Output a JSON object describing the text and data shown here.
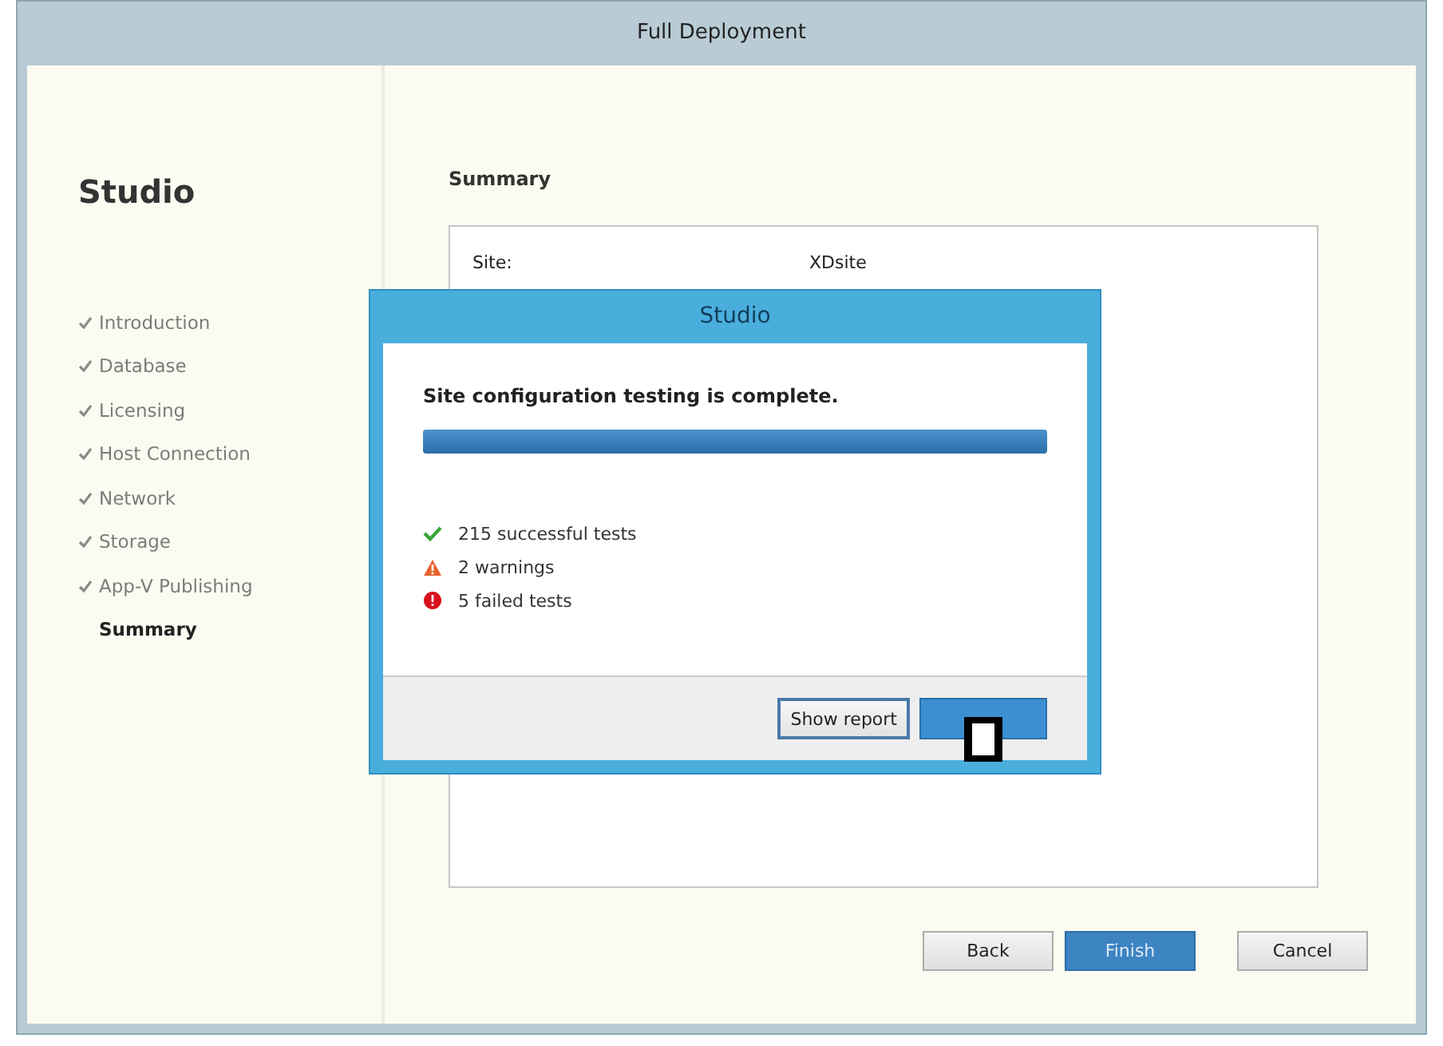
{
  "window": {
    "title": "Full Deployment"
  },
  "sidebar": {
    "title": "Studio",
    "items": [
      {
        "label": "Introduction",
        "completed": true,
        "selected": false
      },
      {
        "label": "Database",
        "completed": true,
        "selected": false
      },
      {
        "label": "Licensing",
        "completed": true,
        "selected": false
      },
      {
        "label": "Host Connection",
        "completed": true,
        "selected": false
      },
      {
        "label": "Network",
        "completed": true,
        "selected": false
      },
      {
        "label": "Storage",
        "completed": true,
        "selected": false
      },
      {
        "label": "App-V Publishing",
        "completed": true,
        "selected": false
      },
      {
        "label": "Summary",
        "completed": false,
        "selected": true
      }
    ]
  },
  "page": {
    "heading": "Summary",
    "rows": [
      {
        "label": "Site:",
        "value": "XDsite"
      }
    ]
  },
  "buttons": [
    {
      "label": "Back",
      "primary": false
    },
    {
      "label": "Finish",
      "primary": true
    },
    {
      "label": "Cancel",
      "primary": false
    }
  ],
  "dialog": {
    "title": "Studio",
    "message": "Site configuration testing is complete.",
    "progress": {
      "level": 1
    },
    "results": [
      {
        "kind": "success",
        "text": "215 successful tests"
      },
      {
        "kind": "warning",
        "text": "2 warnings"
      },
      {
        "kind": "error",
        "text": "5 failed tests"
      }
    ],
    "buttons": [
      {
        "label": "Show report",
        "primary": false
      },
      {
        "primary": true
      }
    ]
  }
}
